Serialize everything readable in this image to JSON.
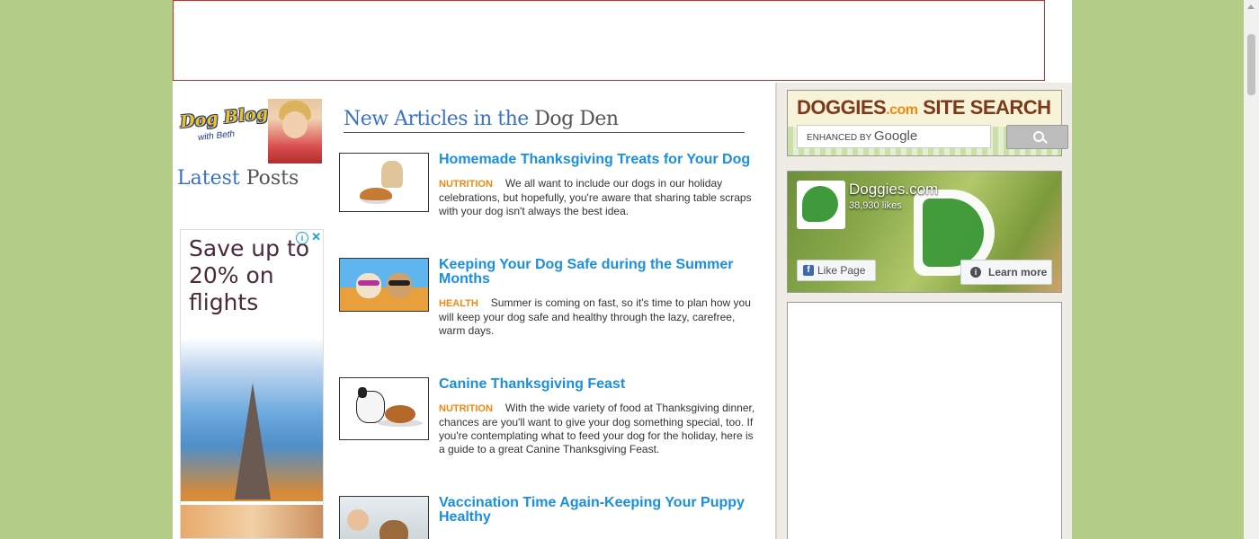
{
  "left": {
    "logo_text": "Dog Blog",
    "logo_sub": "with Beth",
    "latest_accent": "Latest",
    "latest_rest": " Posts",
    "ad": {
      "text": "Save up to 20% on flights",
      "info_icon": "i",
      "close_icon": "✕"
    }
  },
  "main": {
    "title_accent": "New Articles in the",
    "title_rest": " Dog Den",
    "articles": [
      {
        "title": "Homemade Thanksgiving Treats for Your Dog",
        "category": "NUTRITION",
        "excerpt": "We all want to include our dogs in our holiday celebrations, but hopefully, you're aware that sharing table scraps with your dog isn't always the best idea."
      },
      {
        "title": "Keeping Your Dog Safe during the Summer Months",
        "category": "HEALTH",
        "excerpt": "Summer is coming on fast, so it's time to plan how you will keep your dog safe and healthy through the lazy, carefree, warm days."
      },
      {
        "title": "Canine Thanksgiving Feast",
        "category": "NUTRITION",
        "excerpt": "With the wide variety of food at Thanksgiving dinner, chances are you'll want to give your dog something special, too. If you're contemplating what to feed your dog for the holiday, here is a guide to a great Canine Thanksgiving Feast."
      },
      {
        "title": "Vaccination Time Again-Keeping Your Puppy Healthy",
        "category": "",
        "excerpt": ""
      }
    ]
  },
  "right": {
    "search": {
      "brand_name": "DOGGIES",
      "brand_tld": ".com",
      "brand_tail": " SITE SEARCH",
      "placeholder_small": "ENHANCED BY ",
      "placeholder_google": "Google"
    },
    "facebook": {
      "page_name": "Doggies.com",
      "likes": "38,930 likes",
      "like_label": "Like Page",
      "learn_label": "Learn more",
      "fb_icon": "f",
      "info_icon": "i"
    }
  }
}
